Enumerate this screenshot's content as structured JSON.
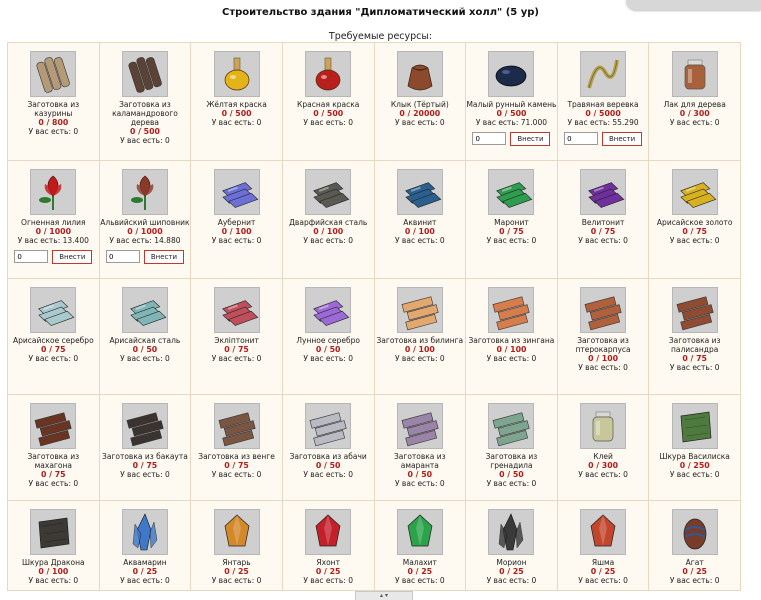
{
  "page": {
    "title": "Строительство здания \"Дипломатический холл\" (5 ур)",
    "subtitle": "Требуемые ресурсы:",
    "have_label": "У вас есть:",
    "deposit_label": "Внести",
    "deposit_default": "0"
  },
  "resources": [
    {
      "name": "Заготовка из казурины",
      "count": "0 / 800",
      "have": "0",
      "icon": "log-icon",
      "color": "#b49a77"
    },
    {
      "name": "Заготовка из каламандрового дерева",
      "count": "0 / 500",
      "have": "0",
      "icon": "log-icon",
      "color": "#5a4236"
    },
    {
      "name": "Жёлтая краска",
      "count": "0 / 500",
      "have": "0",
      "icon": "flask-icon",
      "color": "#e3b419"
    },
    {
      "name": "Красная краска",
      "count": "0 / 500",
      "have": "0",
      "icon": "flask-icon",
      "color": "#b8201e"
    },
    {
      "name": "Клык (Тёртый)",
      "count": "0 / 20000",
      "have": "0",
      "icon": "pouch-icon",
      "color": "#8b4a2e"
    },
    {
      "name": "Малый рунный камень",
      "count": "0 / 500",
      "have": "71.000",
      "icon": "stone-icon",
      "color": "#1d2b4a",
      "deposit": true
    },
    {
      "name": "Травяная веревка",
      "count": "0 / 5000",
      "have": "55.290",
      "icon": "rope-icon",
      "color": "#b3a04d",
      "deposit": true
    },
    {
      "name": "Лак для дерева",
      "count": "0 / 300",
      "have": "0",
      "icon": "jar-icon",
      "color": "#a8623b"
    },
    {
      "name": "Огненная лилия",
      "count": "0 / 1000",
      "have": "13.400",
      "icon": "flower-icon",
      "color": "#c21a1a",
      "deposit": true
    },
    {
      "name": "Альвийский шиповник",
      "count": "0 / 1000",
      "have": "14.880",
      "icon": "flower-icon",
      "color": "#8a3a2a",
      "deposit": true
    },
    {
      "name": "Аубернит",
      "count": "0 / 100",
      "have": "0",
      "icon": "ingot-icon",
      "color": "#6b6fd6"
    },
    {
      "name": "Дварфийская сталь",
      "count": "0 / 100",
      "have": "0",
      "icon": "ingot-icon",
      "color": "#5a5a52"
    },
    {
      "name": "Аквинит",
      "count": "0 / 100",
      "have": "0",
      "icon": "ingot-icon",
      "color": "#2a5f8e"
    },
    {
      "name": "Маронит",
      "count": "0 / 75",
      "have": "0",
      "icon": "ingot-icon",
      "color": "#2e9d4f"
    },
    {
      "name": "Велитонит",
      "count": "0 / 75",
      "have": "0",
      "icon": "ingot-icon",
      "color": "#6f2f9c"
    },
    {
      "name": "Арисайское золото",
      "count": "0 / 75",
      "have": "0",
      "icon": "ingot-icon",
      "color": "#d8b21e"
    },
    {
      "name": "Арисайское серебро",
      "count": "0 / 75",
      "have": "0",
      "icon": "ingot-icon",
      "color": "#a9c9cf"
    },
    {
      "name": "Арисайская сталь",
      "count": "0 / 50",
      "have": "0",
      "icon": "ingot-icon",
      "color": "#7fb5b6"
    },
    {
      "name": "Экліптонит",
      "count": "0 / 75",
      "have": "0",
      "icon": "ingot-icon",
      "color": "#c04f5c"
    },
    {
      "name": "Лунное серебро",
      "count": "0 / 50",
      "have": "0",
      "icon": "ingot-icon",
      "color": "#9c6ad6"
    },
    {
      "name": "Заготовка из билинга",
      "count": "0 / 100",
      "have": "0",
      "icon": "plank-icon",
      "color": "#e3a86d"
    },
    {
      "name": "Заготовка из зингана",
      "count": "0 / 100",
      "have": "0",
      "icon": "plank-icon",
      "color": "#d67d4b"
    },
    {
      "name": "Заготовка из птерокарпуса",
      "count": "0 / 100",
      "have": "0",
      "icon": "plank-icon",
      "color": "#b0603a"
    },
    {
      "name": "Заготовка из палисандра",
      "count": "0 / 75",
      "have": "0",
      "icon": "plank-icon",
      "color": "#8f4c33"
    },
    {
      "name": "Заготовка из махагона",
      "count": "0 / 75",
      "have": "0",
      "icon": "plank-icon",
      "color": "#6a3423"
    },
    {
      "name": "Заготовка из бакаута",
      "count": "0 / 75",
      "have": "0",
      "icon": "plank-icon",
      "color": "#3b3330"
    },
    {
      "name": "Заготовка из венге",
      "count": "0 / 75",
      "have": "0",
      "icon": "plank-icon",
      "color": "#7a5541"
    },
    {
      "name": "Заготовка из абачи",
      "count": "0 / 50",
      "have": "0",
      "icon": "plank-icon",
      "color": "#b9bac4"
    },
    {
      "name": "Заготовка из амаранта",
      "count": "0 / 50",
      "have": "0",
      "icon": "plank-icon",
      "color": "#9a84a8"
    },
    {
      "name": "Заготовка из гренадила",
      "count": "0 / 50",
      "have": "0",
      "icon": "plank-icon",
      "color": "#7ea58f"
    },
    {
      "name": "Клей",
      "count": "0 / 300",
      "have": "0",
      "icon": "jar-icon",
      "color": "#c7c79a"
    },
    {
      "name": "Шкура Василиска",
      "count": "0 / 250",
      "have": "0",
      "icon": "hide-icon",
      "color": "#4f7a3f"
    },
    {
      "name": "Шкура Дракона",
      "count": "0 / 100",
      "have": "0",
      "icon": "hide-icon",
      "color": "#3d3a36"
    },
    {
      "name": "Аквамарин",
      "count": "0 / 25",
      "have": "0",
      "icon": "crystal-icon",
      "color": "#3f78c9"
    },
    {
      "name": "Янтарь",
      "count": "0 / 25",
      "have": "0",
      "icon": "gem-icon",
      "color": "#d3882a"
    },
    {
      "name": "Яхонт",
      "count": "0 / 25",
      "have": "0",
      "icon": "gem-icon",
      "color": "#c3202a"
    },
    {
      "name": "Малахит",
      "count": "0 / 25",
      "have": "0",
      "icon": "gem-icon",
      "color": "#2aa34a"
    },
    {
      "name": "Морион",
      "count": "0 / 25",
      "have": "0",
      "icon": "crystal-icon",
      "color": "#3a3a3a"
    },
    {
      "name": "Яшма",
      "count": "0 / 25",
      "have": "0",
      "icon": "gem-icon",
      "color": "#c2452c"
    },
    {
      "name": "Агат",
      "count": "0 / 25",
      "have": "0",
      "icon": "egg-icon",
      "color": "#7a3c2a"
    }
  ]
}
